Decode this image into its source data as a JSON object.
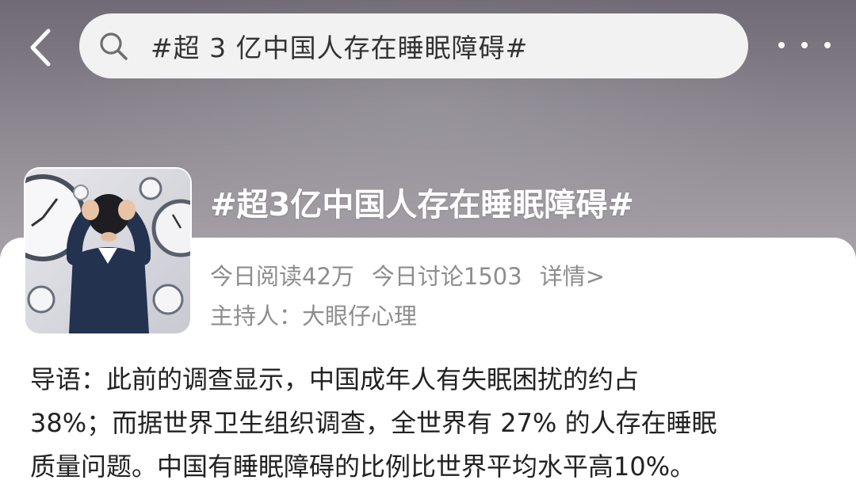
{
  "header": {
    "search_query": "#超 3 亿中国人存在睡眠障碍#"
  },
  "topic": {
    "title": "#超3亿中国人存在睡眠障碍#",
    "reads_today": "今日阅读42万",
    "discussions_today": "今日讨论1503",
    "details_link": "详情>",
    "host": "主持人：大眼仔心理"
  },
  "intro": {
    "lines": [
      "导语：此前的调查显示，中国成年人有失眠困扰的约占",
      "38%；而据世界卫生组织调查，全世界有 27% 的人存在睡眠",
      "质量问题。中国有睡眠障碍的比例比世界平均水平高10%。"
    ]
  },
  "icons": {
    "back": "chevron-left-icon",
    "search": "search-icon",
    "more": "more-dots-icon"
  },
  "colors": {
    "hero_bg": "#8a858e",
    "search_bg": "#f3f2f3",
    "meta_text": "#8d8d8d",
    "body_text": "#222222"
  }
}
